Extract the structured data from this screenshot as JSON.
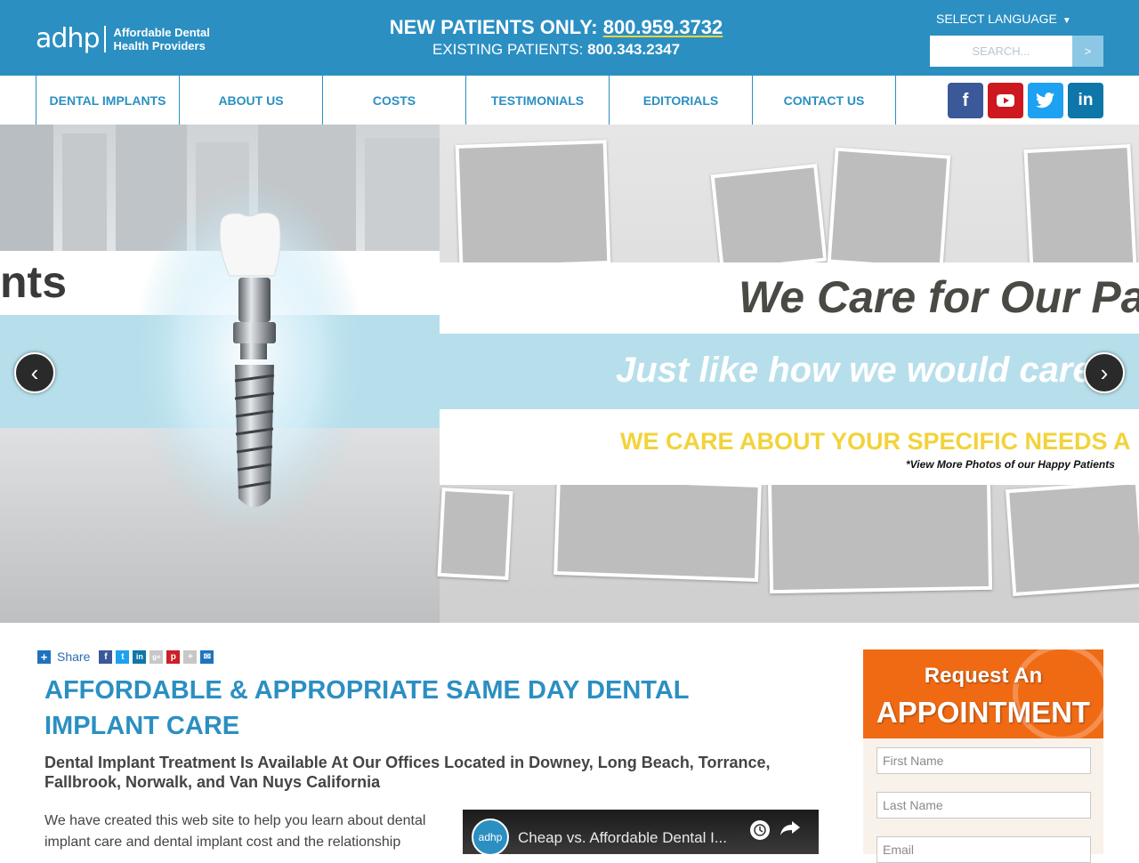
{
  "header": {
    "logo_mark": "adhp",
    "logo_text": "Affordable Dental Health Providers",
    "new_patients_label": "NEW PATIENTS ONLY: ",
    "new_patients_phone": "800.959.3732",
    "existing_label": "EXISTING PATIENTS: ",
    "existing_phone": "800.343.2347",
    "language_label": "SELECT LANGUAGE",
    "search_placeholder": "SEARCH...",
    "search_button": ">"
  },
  "nav": {
    "items": [
      {
        "label": "DENTAL IMPLANTS"
      },
      {
        "label": "ABOUT US"
      },
      {
        "label": "COSTS"
      },
      {
        "label": "TESTIMONIALS"
      },
      {
        "label": "EDITORIALS"
      },
      {
        "label": "CONTACT US"
      }
    ],
    "socials": [
      {
        "icon": "facebook-icon",
        "glyph": "f",
        "color": "#3b5998"
      },
      {
        "icon": "youtube-icon",
        "glyph": "▶",
        "color": "#cc181e"
      },
      {
        "icon": "twitter-icon",
        "glyph": "🐦",
        "color": "#1da1f2"
      },
      {
        "icon": "linkedin-icon",
        "glyph": "in",
        "color": "#0e76a8"
      }
    ]
  },
  "hero": {
    "left_text": "nts",
    "headline": "We Care for Our Pa",
    "tagline": "Just like how we would care f",
    "needs": "WE CARE ABOUT YOUR SPECIFIC NEEDS A",
    "more_photos": "*View More Photos of our Happy Patients",
    "prev_glyph": "‹",
    "next_glyph": "›"
  },
  "share": {
    "label": "Share",
    "icons": [
      {
        "icon": "facebook-icon",
        "glyph": "f",
        "color": "#3b5998"
      },
      {
        "icon": "twitter-icon",
        "glyph": "t",
        "color": "#1da1f2"
      },
      {
        "icon": "linkedin-icon",
        "glyph": "in",
        "color": "#0e76a8"
      },
      {
        "icon": "google-plus-icon",
        "glyph": "g+",
        "color": "#c7c7c7"
      },
      {
        "icon": "pinterest-icon",
        "glyph": "p",
        "color": "#cb2027"
      },
      {
        "icon": "more-icon",
        "glyph": "+",
        "color": "#c7c7c7"
      },
      {
        "icon": "email-icon",
        "glyph": "✉",
        "color": "#1e73be"
      }
    ]
  },
  "content": {
    "title": "AFFORDABLE & APPROPRIATE SAME DAY DENTAL IMPLANT CARE",
    "subtitle": "Dental Implant Treatment Is Available At Our Offices Located in Downey, Long Beach, Torrance, Fallbrook, Norwalk, and Van Nuys California",
    "body": "We have created this web site to help you learn about dental implant care and dental implant cost and the relationship",
    "video_logo": "adhp",
    "video_title": "Cheap vs. Affordable Dental I..."
  },
  "appointment": {
    "line1": "Request An",
    "line2": "APPOINTMENT",
    "first_name_placeholder": "First Name",
    "last_name_placeholder": "Last Name",
    "email_placeholder": "Email"
  }
}
